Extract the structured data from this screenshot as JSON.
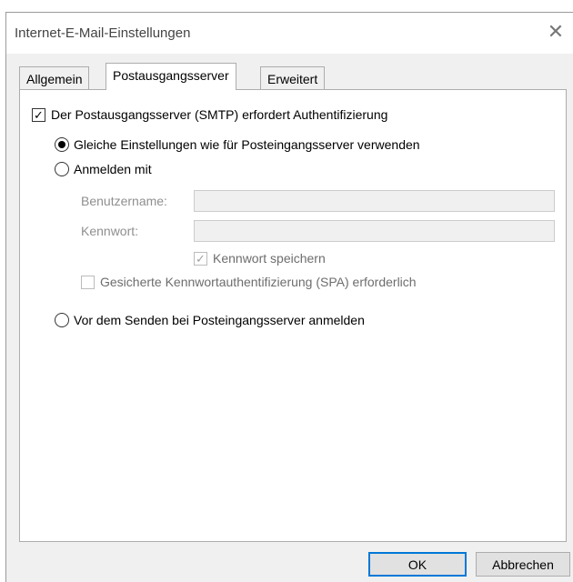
{
  "window": {
    "title": "Internet-E-Mail-Einstellungen",
    "close_glyph": "✕"
  },
  "tabs": [
    {
      "label": "Allgemein",
      "active": false
    },
    {
      "label": "Postausgangsserver",
      "active": true
    },
    {
      "label": "Erweitert",
      "active": false
    }
  ],
  "smtp_auth": {
    "label": "Der Postausgangsserver (SMTP) erfordert Authentifizierung",
    "checked": true
  },
  "auth_options": {
    "same_settings": {
      "label": "Gleiche Einstellungen wie für Posteingangsserver verwenden",
      "selected": true
    },
    "login_with": {
      "label": "Anmelden mit",
      "selected": false
    },
    "login_before_send": {
      "label": "Vor dem Senden bei Posteingangsserver anmelden",
      "selected": false
    }
  },
  "login_fields": {
    "username_label": "Benutzername:",
    "username_value": "",
    "password_label": "Kennwort:",
    "password_value": "",
    "save_password": {
      "label": "Kennwort speichern",
      "checked": true,
      "enabled": false
    },
    "spa": {
      "label": "Gesicherte Kennwortauthentifizierung (SPA) erforderlich",
      "checked": false,
      "enabled": false
    }
  },
  "buttons": {
    "ok": "OK",
    "cancel": "Abbrechen"
  }
}
